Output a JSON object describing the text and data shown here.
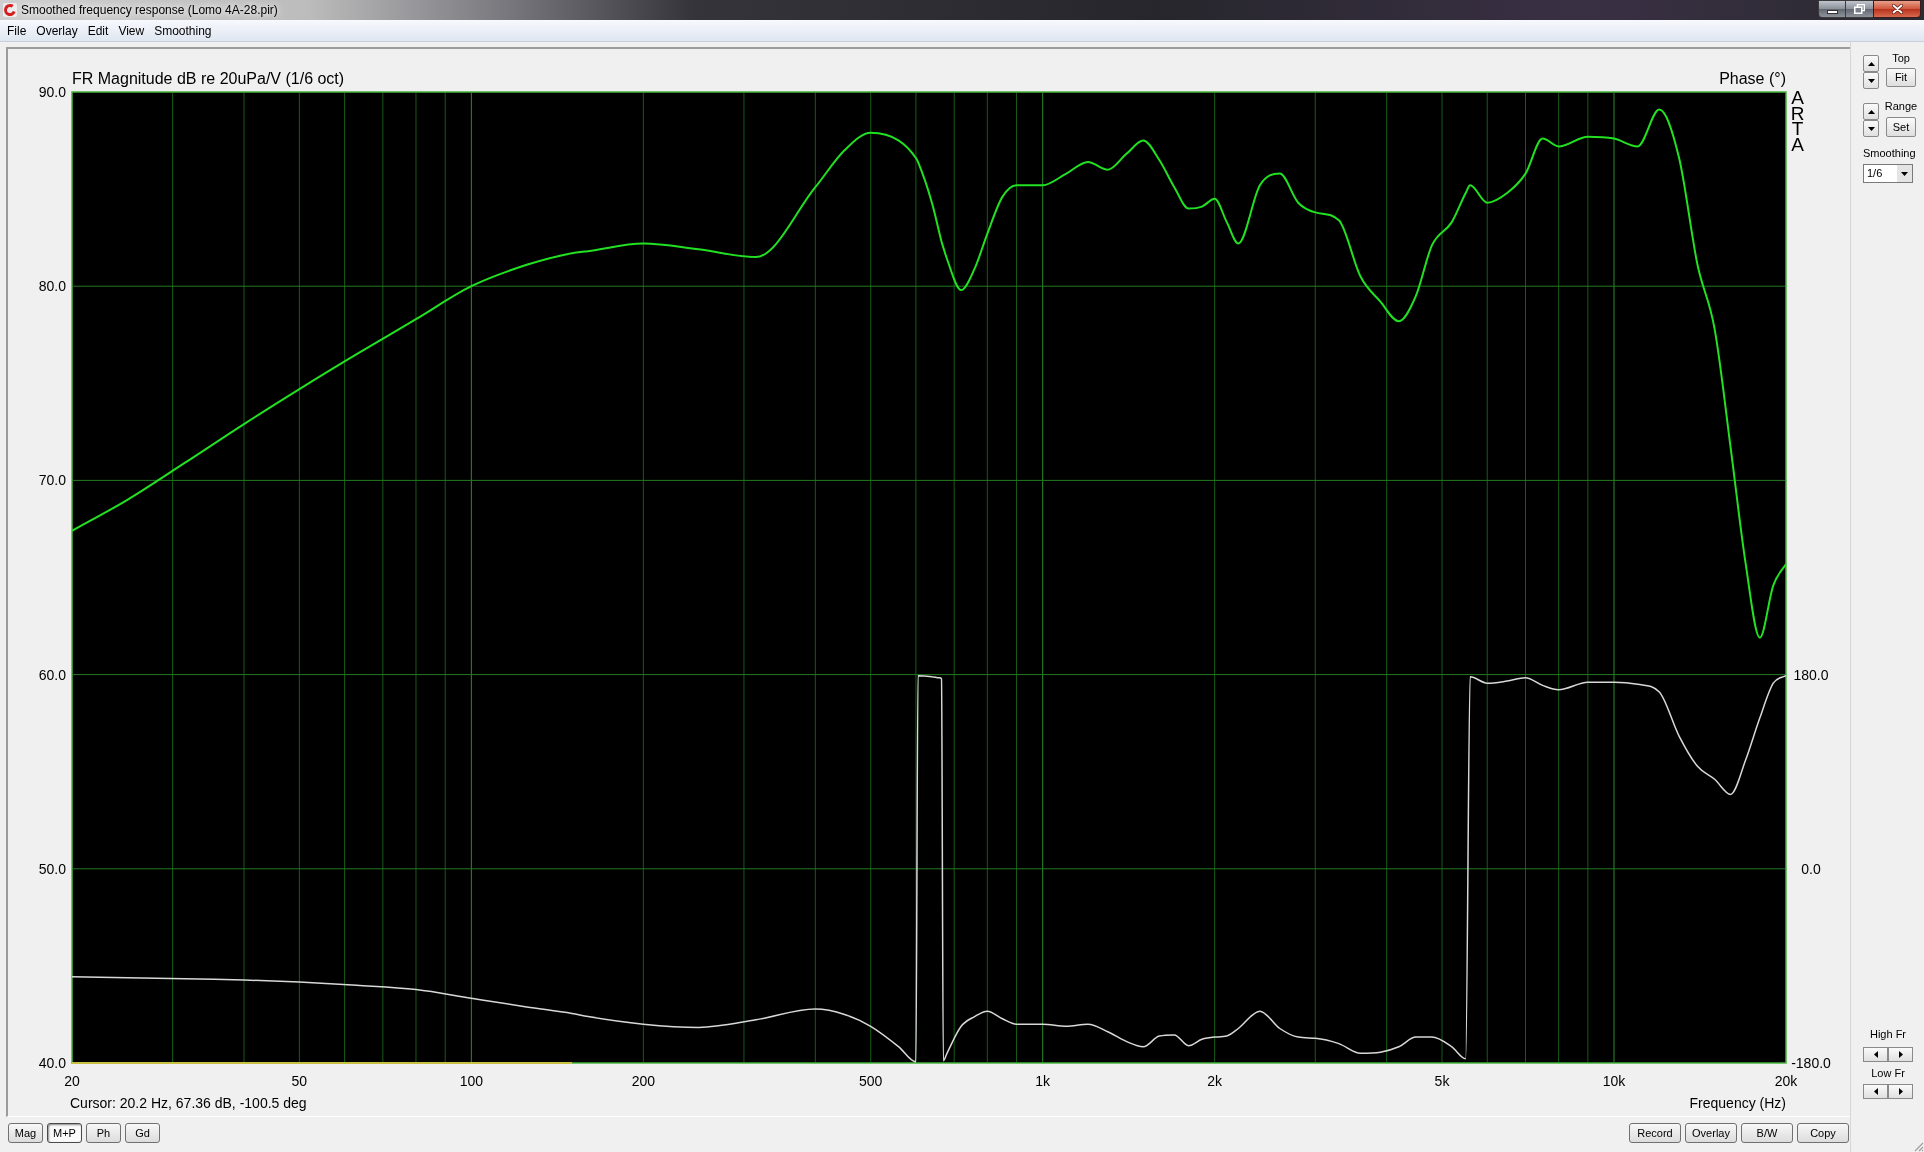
{
  "window": {
    "title": "Smoothed frequency response (Lomo 4A-28.pir)"
  },
  "menu": [
    "File",
    "Overlay",
    "Edit",
    "View",
    "Smoothing"
  ],
  "plot": {
    "chart_data": {
      "type": "line",
      "title": "FR Magnitude dB re 20uPa/V (1/6 oct)",
      "xlabel": "Frequency (Hz)",
      "y2label": "Phase (°)",
      "log": "x",
      "grid": true,
      "xlim": [
        20,
        20000
      ],
      "ylim": [
        40,
        90
      ],
      "y2lim": [
        -180,
        720
      ],
      "xticks": [
        {
          "value": 20,
          "label": "20"
        },
        {
          "value": 50,
          "label": "50"
        },
        {
          "value": 100,
          "label": "100"
        },
        {
          "value": 200,
          "label": "200"
        },
        {
          "value": 500,
          "label": "500"
        },
        {
          "value": 1000,
          "label": "1k"
        },
        {
          "value": 2000,
          "label": "2k"
        },
        {
          "value": 5000,
          "label": "5k"
        },
        {
          "value": 10000,
          "label": "10k"
        },
        {
          "value": 20000,
          "label": "20k"
        }
      ],
      "yticks": [
        {
          "value": 90,
          "label": "90.0"
        },
        {
          "value": 80,
          "label": "80.0"
        },
        {
          "value": 70,
          "label": "70.0"
        },
        {
          "value": 60,
          "label": "60.0"
        },
        {
          "value": 50,
          "label": "50.0"
        },
        {
          "value": 40,
          "label": "40.0"
        }
      ],
      "y2ticks": [
        {
          "value": 180,
          "label": "180.0"
        },
        {
          "value": 0,
          "label": "0.0"
        },
        {
          "value": -180,
          "label": "-180.0"
        }
      ],
      "x": [
        20,
        25,
        31.5,
        40,
        50,
        63,
        80,
        100,
        125,
        150,
        160,
        200,
        250,
        315,
        400,
        450,
        500,
        560,
        600,
        605,
        640,
        660,
        665,
        670,
        680,
        720,
        760,
        800,
        850,
        900,
        1000,
        1100,
        1200,
        1300,
        1400,
        1500,
        1600,
        1700,
        1800,
        1900,
        2000,
        2100,
        2200,
        2400,
        2600,
        2800,
        3000,
        3300,
        3600,
        3900,
        4200,
        4500,
        4800,
        5200,
        5500,
        5600,
        6000,
        6500,
        7000,
        7500,
        8000,
        9000,
        10000,
        11000,
        12000,
        13000,
        14000,
        15000,
        16000,
        17000,
        18000,
        19000,
        20000
      ],
      "series": [
        {
          "color": "#22e022",
          "values": [
            67.4,
            69.0,
            70.9,
            72.9,
            74.7,
            76.5,
            78.3,
            80.0,
            81.1,
            81.7,
            81.8,
            82.2,
            81.9,
            81.5,
            85.1,
            87.0,
            87.9,
            87.5,
            86.6,
            86.4,
            84.3,
            82.7,
            82.3,
            82.0,
            81.4,
            79.8,
            80.9,
            82.7,
            84.6,
            85.2,
            85.2,
            85.8,
            86.4,
            86.0,
            86.8,
            87.5,
            86.5,
            85.1,
            84.0,
            84.1,
            84.5,
            83.3,
            82.2,
            85.2,
            85.8,
            84.3,
            83.8,
            83.4,
            80.5,
            79.2,
            78.2,
            79.5,
            82.1,
            83.3,
            84.8,
            85.2,
            84.3,
            84.8,
            85.8,
            87.6,
            87.2,
            87.7,
            87.6,
            87.2,
            89.1,
            86.6,
            81.1,
            77.8,
            71.7,
            65.7,
            61.9,
            64.6,
            65.7
          ]
        },
        {
          "color": "#d8d8d8",
          "axis": "y2",
          "values": [
            -100,
            -101,
            -102,
            -103,
            -105,
            -108,
            -112,
            -120,
            -128,
            -134,
            -137,
            -144,
            -147,
            -140,
            -130,
            -135,
            -146,
            -165,
            -179,
            179,
            178,
            177,
            176,
            -178,
            -171,
            -146,
            -137,
            -132,
            -139,
            -144,
            -144,
            -146,
            -144,
            -151,
            -160,
            -165,
            -155,
            -154,
            -164,
            -158,
            -156,
            -155,
            -148,
            -132,
            -148,
            -156,
            -157,
            -162,
            -171,
            -170,
            -165,
            -156,
            -156,
            -165,
            -176,
            178,
            172,
            174,
            177,
            170,
            166,
            173,
            173,
            171,
            164,
            123,
            95,
            83,
            69,
            101,
            140,
            172,
            179
          ]
        },
        {
          "color": "#c8c040",
          "values": [
            40,
            40,
            40,
            40,
            40,
            40,
            40,
            40,
            40,
            40,
            null,
            null,
            null,
            null,
            null,
            null,
            null,
            null,
            null,
            null,
            null,
            null,
            null,
            null,
            null,
            null,
            null,
            null,
            null,
            null,
            null,
            null,
            null,
            null,
            null,
            null,
            null,
            null,
            null,
            null,
            null,
            null,
            null,
            null,
            null,
            null,
            null,
            null,
            null,
            null,
            null,
            null,
            null,
            null,
            null,
            null,
            null,
            null,
            null,
            null,
            null,
            null,
            null,
            null,
            null,
            null,
            null,
            null,
            null,
            null,
            null,
            null,
            null
          ]
        }
      ]
    },
    "logo_text": "ARTA",
    "cursor_readout": "Cursor: 20.2 Hz, 67.36 dB, -100.5 deg"
  },
  "view_buttons": [
    {
      "label": "Mag",
      "selected": false
    },
    {
      "label": "M+P",
      "selected": true
    },
    {
      "label": "Ph",
      "selected": false
    },
    {
      "label": "Gd",
      "selected": false
    }
  ],
  "action_buttons": [
    "Record",
    "Overlay",
    "B/W",
    "Copy"
  ],
  "side_panel": {
    "top_label": "Top",
    "fit_button": "Fit",
    "range_label": "Range",
    "set_button": "Set",
    "smoothing_label": "Smoothing",
    "smoothing_value": "1/6",
    "high_fr_label": "High Fr",
    "low_fr_label": "Low Fr"
  }
}
